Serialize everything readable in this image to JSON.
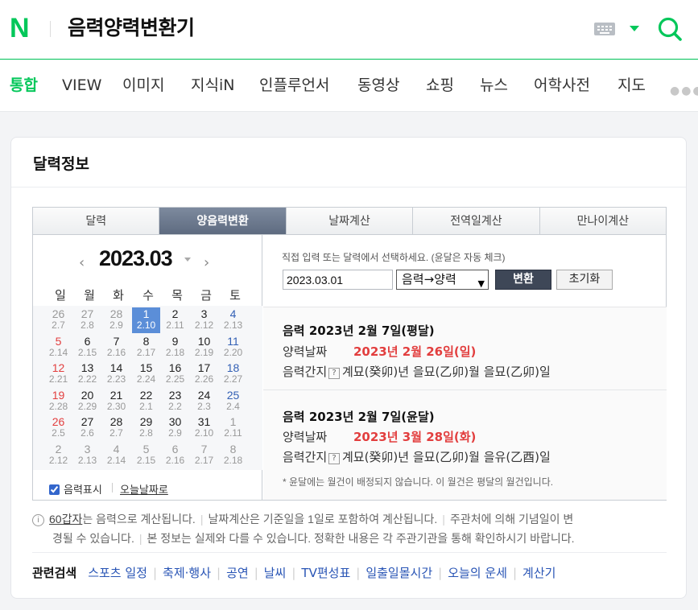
{
  "header": {
    "logo": "N",
    "query": "음력양력변환기",
    "colors": {
      "brand": "#03c75a"
    },
    "icons": [
      "keyboard-icon",
      "chevron-down-icon",
      "search-icon"
    ]
  },
  "tabs": [
    "통합",
    "VIEW",
    "이미지",
    "지식iN",
    "인플루언서",
    "동영상",
    "쇼핑",
    "뉴스",
    "어학사전",
    "지도"
  ],
  "card": {
    "title": "달력정보",
    "subtabs": [
      "달력",
      "양음력변환",
      "날짜계산",
      "전역일계산",
      "만나이계산"
    ],
    "calendar": {
      "title": "2023.03",
      "weekdays": [
        "일",
        "월",
        "화",
        "수",
        "목",
        "금",
        "토"
      ],
      "days": [
        [
          [
            "26",
            "2.7"
          ],
          [
            "27",
            "2.8"
          ],
          [
            "28",
            "2.9"
          ],
          [
            "1",
            "2.10"
          ],
          [
            "2",
            "2.11"
          ],
          [
            "3",
            "2.12"
          ],
          [
            "4",
            "2.13"
          ]
        ],
        [
          [
            "5",
            "2.14"
          ],
          [
            "6",
            "2.15"
          ],
          [
            "7",
            "2.16"
          ],
          [
            "8",
            "2.17"
          ],
          [
            "9",
            "2.18"
          ],
          [
            "10",
            "2.19"
          ],
          [
            "11",
            "2.20"
          ]
        ],
        [
          [
            "12",
            "2.21"
          ],
          [
            "13",
            "2.22"
          ],
          [
            "14",
            "2.23"
          ],
          [
            "15",
            "2.24"
          ],
          [
            "16",
            "2.25"
          ],
          [
            "17",
            "2.26"
          ],
          [
            "18",
            "2.27"
          ]
        ],
        [
          [
            "19",
            "2.28"
          ],
          [
            "20",
            "2.29"
          ],
          [
            "21",
            "2.30"
          ],
          [
            "22",
            "2.1"
          ],
          [
            "23",
            "2.2"
          ],
          [
            "24",
            "2.3"
          ],
          [
            "25",
            "2.4"
          ]
        ],
        [
          [
            "26",
            "2.5"
          ],
          [
            "27",
            "2.6"
          ],
          [
            "28",
            "2.7"
          ],
          [
            "29",
            "2.8"
          ],
          [
            "30",
            "2.9"
          ],
          [
            "31",
            "2.10"
          ],
          [
            "1",
            "2.11"
          ]
        ],
        [
          [
            "2",
            "2.12"
          ],
          [
            "3",
            "2.13"
          ],
          [
            "4",
            "2.14"
          ],
          [
            "5",
            "2.15"
          ],
          [
            "6",
            "2.16"
          ],
          [
            "7",
            "2.17"
          ],
          [
            "8",
            "2.18"
          ]
        ]
      ],
      "checkbox_label": "음력표시",
      "today_link": "오늘날짜로"
    },
    "converter": {
      "hint": "직접 입력 또는 달력에서 선택하세요. (윤달은 자동 체크)",
      "date_value": "2023.03.01",
      "mode": "음력→양력",
      "convert_label": "변환",
      "reset_label": "초기화"
    },
    "results": [
      {
        "title": "음력 2023년 2월 7일(평달)",
        "solar_key": "양력날짜",
        "solar_value": "2023년 2월 26일(일)",
        "ganji_key": "음력간지",
        "ganji_value": "계묘(癸卯)년 을묘(乙卯)월 을묘(乙卯)일"
      },
      {
        "title": "음력 2023년 2월 7일(윤달)",
        "solar_key": "양력날짜",
        "solar_value": "2023년 3월 28일(화)",
        "ganji_key": "음력간지",
        "ganji_value": "계묘(癸卯)년 을묘(乙卯)월 을유(乙酉)일"
      }
    ],
    "leap_note": "* 윤달에는 월건이 배정되지 않습니다. 이 월건은 평달의 월건입니다.",
    "info": {
      "link": "60갑자",
      "t1": "는 음력으로 계산됩니다.",
      "t2": "날짜계산은 기준일을 1일로 포함하여 계산됩니다.",
      "t3": "주관처에 의해 기념일이 변",
      "t4": "경될 수 있습니다.",
      "t5": "본 정보는 실제와 다를 수 있습니다. 정확한 내용은 각 주관기관을 통해 확인하시기 바랍니다."
    },
    "related": {
      "label": "관련검색",
      "links": [
        "스포츠 일정",
        "축제·행사",
        "공연",
        "날씨",
        "TV편성표",
        "일출일몰시간",
        "오늘의 운세",
        "계산기"
      ]
    }
  }
}
